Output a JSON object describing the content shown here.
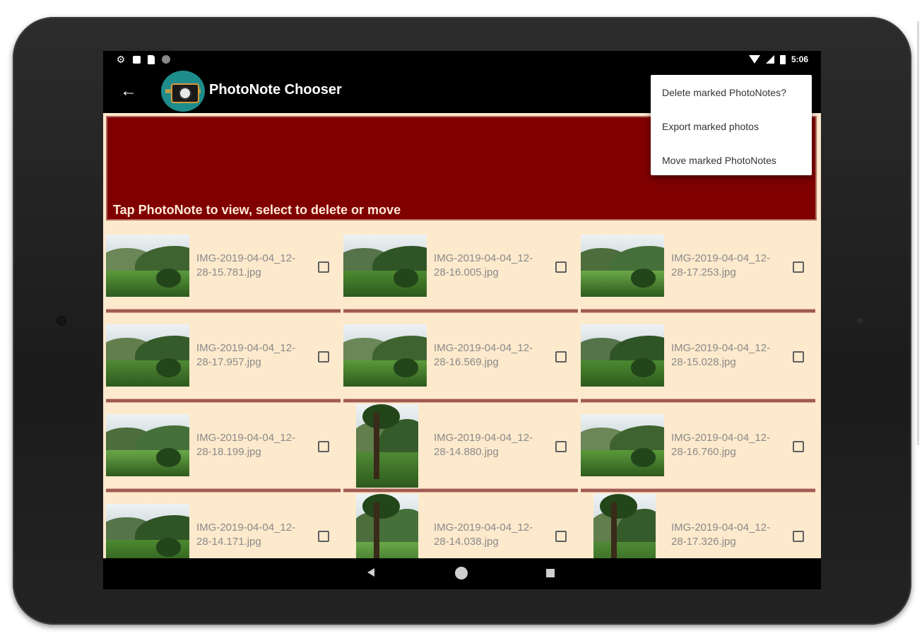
{
  "app": {
    "title": "PhotoNote Chooser",
    "time": "5:06"
  },
  "banner": {
    "text": "Tap PhotoNote to view, select to delete or move"
  },
  "menu": {
    "items": [
      {
        "label": "Delete marked PhotoNotes?"
      },
      {
        "label": "Export marked photos"
      },
      {
        "label": "Move marked PhotoNotes"
      }
    ]
  },
  "photos": [
    {
      "line1": "IMG-2019-04-04_12-",
      "line2": "28-15.781.jpg",
      "orientation": "landscape",
      "checked": false
    },
    {
      "line1": "IMG-2019-04-04_12-",
      "line2": "28-16.005.jpg",
      "orientation": "landscape",
      "checked": false
    },
    {
      "line1": "IMG-2019-04-04_12-",
      "line2": "28-17.253.jpg",
      "orientation": "landscape",
      "checked": false
    },
    {
      "line1": "IMG-2019-04-04_12-",
      "line2": "28-17.957.jpg",
      "orientation": "landscape",
      "checked": false
    },
    {
      "line1": "IMG-2019-04-04_12-",
      "line2": "28-16.569.jpg",
      "orientation": "landscape",
      "checked": false
    },
    {
      "line1": "IMG-2019-04-04_12-",
      "line2": "28-15.028.jpg",
      "orientation": "landscape",
      "checked": false
    },
    {
      "line1": "IMG-2019-04-04_12-",
      "line2": "28-18.199.jpg",
      "orientation": "landscape",
      "checked": false
    },
    {
      "line1": "IMG-2019-04-04_12-",
      "line2": "28-14.880.jpg",
      "orientation": "portrait",
      "checked": false
    },
    {
      "line1": "IMG-2019-04-04_12-",
      "line2": "28-16.760.jpg",
      "orientation": "landscape",
      "checked": false
    },
    {
      "line1": "IMG-2019-04-04_12-",
      "line2": "28-14.171.jpg",
      "orientation": "landscape",
      "checked": false
    },
    {
      "line1": "IMG-2019-04-04_12-",
      "line2": "28-14.038.jpg",
      "orientation": "portrait",
      "checked": false
    },
    {
      "line1": "IMG-2019-04-04_12-",
      "line2": "28-17.326.jpg",
      "orientation": "portrait",
      "checked": false
    }
  ],
  "colors": {
    "banner": "#800000",
    "background": "#fde9cc",
    "separator": "#a05c52"
  }
}
